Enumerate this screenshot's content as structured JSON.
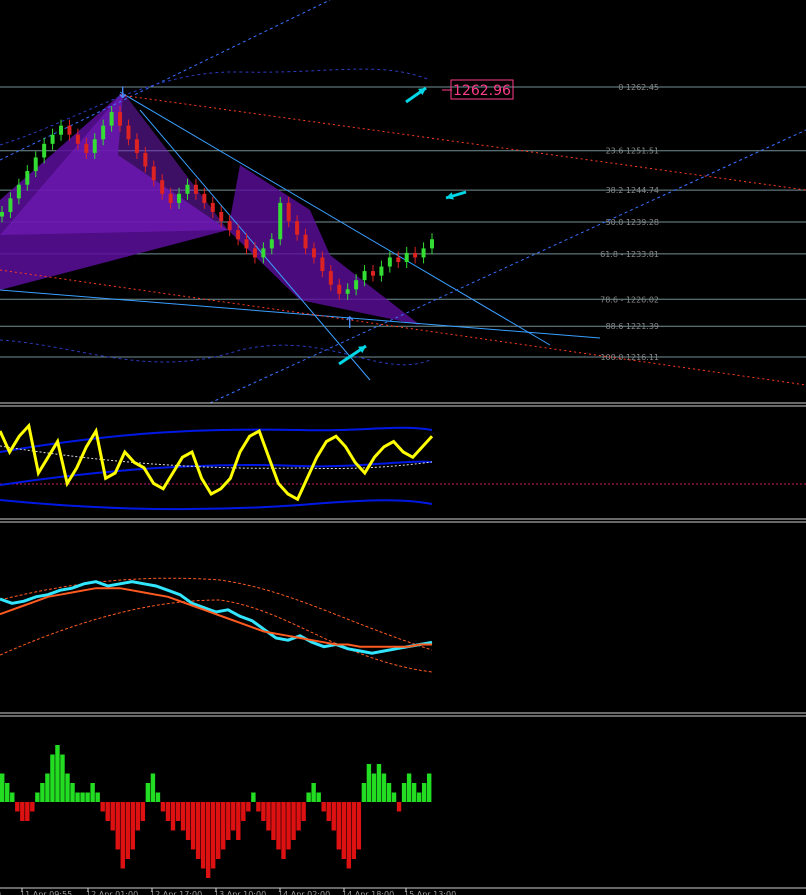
{
  "price_tag": "1262.96",
  "fib_levels": [
    {
      "label": "0 1262.45",
      "price": 1262.45
    },
    {
      "label": "23.6 1251.51",
      "price": 1251.51
    },
    {
      "label": "38.2 1244.74",
      "price": 1244.74
    },
    {
      "label": "50.0 1239.28",
      "price": 1239.28
    },
    {
      "label": "61.8 - 1233.81",
      "price": 1233.81
    },
    {
      "label": "78.6 - 1226.02",
      "price": 1226.02
    },
    {
      "label": "88.6 1221.39",
      "price": 1221.39
    },
    {
      "label": "100.0 1216.11",
      "price": 1216.11
    }
  ],
  "time_labels": [
    "9",
    "11 Apr 09:55",
    "12 Apr 01:00",
    "12 Apr 17:00",
    "13 Apr 10:00",
    "14 Apr 02:00",
    "14 Apr 18:00",
    "15 Apr 13:00"
  ],
  "colors": {
    "background": "#000000",
    "fib_line": "#6f8f96",
    "pattern_fill": "#5c0e9c",
    "channel_line": "#1e90ff",
    "trend_dotted": "#ff3b1f",
    "arrow": "#00d7e6",
    "price_tag": "#ff3b8a",
    "stoch_main": "#ffff00",
    "stoch_band": "#0018e6",
    "rsi_line": "#33e6ff",
    "rsi_ma": "#ff5a1f",
    "hist_up": "#22dd22",
    "hist_down": "#dd1111"
  },
  "chart_data": [
    {
      "type": "line",
      "title": "",
      "series": [
        {
          "values": [
            1240,
            1243,
            1246,
            1249,
            1252,
            1255,
            1257,
            1259,
            1257,
            1255,
            1253,
            1256,
            1259,
            1262,
            1259,
            1256,
            1253,
            1250,
            1247,
            1244,
            1242,
            1244,
            1246,
            1244,
            1242,
            1240,
            1238,
            1236,
            1234,
            1232,
            1230,
            1232,
            1234,
            1242,
            1238,
            1235,
            1232,
            1230,
            1227,
            1224,
            1222,
            1223,
            1225,
            1227,
            1226,
            1228,
            1230,
            1229,
            1231,
            1230,
            1232,
            1234
          ]
        }
      ],
      "ylim": [
        1207,
        1273
      ]
    },
    {
      "type": "line",
      "series": [
        {
          "values": [
            80,
            60,
            75,
            85,
            40,
            55,
            70,
            30,
            45,
            65,
            80,
            35,
            40,
            60,
            50,
            45,
            30,
            25,
            40,
            55,
            60,
            35,
            20,
            25,
            35,
            60,
            75,
            80,
            55,
            30,
            20,
            15,
            35,
            55,
            70,
            75,
            65,
            50,
            40,
            55,
            65,
            70,
            60,
            55,
            65,
            75
          ]
        }
      ],
      "ylim": [
        0,
        100
      ]
    },
    {
      "type": "line",
      "series": [
        {
          "values": [
            62,
            60,
            61,
            63,
            64,
            66,
            67,
            69,
            70,
            68,
            69,
            70,
            69,
            68,
            66,
            64,
            60,
            58,
            56,
            57,
            54,
            52,
            48,
            44,
            43,
            45,
            42,
            40,
            41,
            39,
            38,
            37,
            38,
            39,
            40,
            41,
            42
          ]
        },
        {
          "values": [
            55,
            57,
            59,
            61,
            63,
            64,
            65,
            66,
            67,
            67,
            67,
            66,
            65,
            64,
            63,
            61,
            59,
            57,
            55,
            53,
            51,
            49,
            47,
            46,
            45,
            44,
            43,
            42,
            41,
            41,
            40,
            40,
            40,
            40,
            40,
            41,
            41
          ]
        }
      ],
      "ylim": [
        20,
        80
      ]
    },
    {
      "type": "bar",
      "values": [
        3,
        2,
        1,
        -1,
        -2,
        -2,
        -1,
        1,
        2,
        3,
        5,
        6,
        5,
        3,
        2,
        1,
        1,
        1,
        2,
        1,
        -1,
        -2,
        -3,
        -5,
        -7,
        -6,
        -5,
        -3,
        -2,
        2,
        3,
        1,
        -1,
        -2,
        -3,
        -2,
        -3,
        -4,
        -5,
        -6,
        -7,
        -8,
        -7,
        -6,
        -5,
        -4,
        -3,
        -4,
        -2,
        -1,
        1,
        -1,
        -2,
        -3,
        -4,
        -5,
        -6,
        -5,
        -4,
        -3,
        -2,
        1,
        2,
        1,
        -1,
        -2,
        -3,
        -5,
        -6,
        -7,
        -6,
        -5,
        2,
        4,
        3,
        4,
        3,
        2,
        1,
        -1,
        2,
        3,
        2,
        1,
        2,
        3
      ]
    }
  ]
}
